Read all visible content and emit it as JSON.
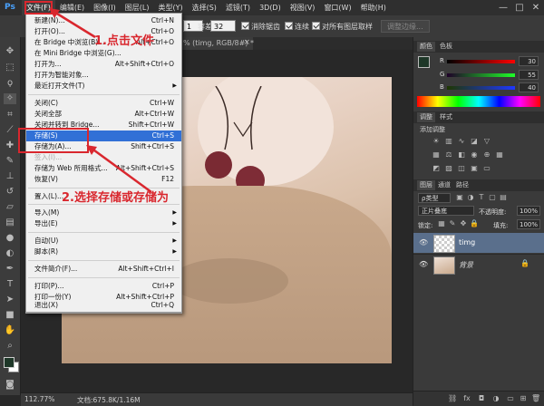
{
  "menubar": {
    "items": [
      "文件(F)",
      "编辑(E)",
      "图像(I)",
      "图层(L)",
      "类型(Y)",
      "选择(S)",
      "滤镜(T)",
      "3D(D)",
      "视图(V)",
      "窗口(W)",
      "帮助(H)"
    ],
    "window_controls": [
      "—",
      "□",
      "✕"
    ]
  },
  "options": {
    "size_value": "1",
    "tolerance_label": "容差:",
    "tolerance_value": "32",
    "antialias_label": "消除锯齿",
    "contiguous_label": "连续",
    "all_layers_label": "对所有图层取样",
    "refine_edge_label": "调整边缘..."
  },
  "document": {
    "tab_title": "% (timg, RGB/8#) *",
    "tab_close": "×",
    "zoom": "112.77%",
    "doc_info": "文档:675.8K/1.16M"
  },
  "file_menu": {
    "items": [
      {
        "label": "新建(N)...",
        "shortcut": "Ctrl+N"
      },
      {
        "label": "打开(O)...",
        "shortcut": "Ctrl+O"
      },
      {
        "label": "在 Bridge 中浏览(B)...",
        "shortcut": "Alt+Ctrl+O"
      },
      {
        "label": "在 Mini Bridge 中浏览(G)...",
        "shortcut": ""
      },
      {
        "label": "打开为...",
        "shortcut": "Alt+Shift+Ctrl+O"
      },
      {
        "label": "打开为智能对象...",
        "shortcut": ""
      },
      {
        "label": "最近打开文件(T)",
        "shortcut": ""
      },
      {
        "label": "关闭(C)",
        "shortcut": "Ctrl+W"
      },
      {
        "label": "关闭全部",
        "shortcut": "Alt+Ctrl+W"
      },
      {
        "label": "关闭并转到 Bridge...",
        "shortcut": "Shift+Ctrl+W"
      },
      {
        "label": "存储(S)",
        "shortcut": "Ctrl+S"
      },
      {
        "label": "存储为(A)...",
        "shortcut": "Shift+Ctrl+S"
      },
      {
        "label": "签入(I)...",
        "shortcut": ""
      },
      {
        "label": "存储为 Web 所用格式...",
        "shortcut": "Alt+Shift+Ctrl+S"
      },
      {
        "label": "恢复(V)",
        "shortcut": "F12"
      },
      {
        "label": "置入(L)...",
        "shortcut": ""
      },
      {
        "label": "导入(M)",
        "shortcut": ""
      },
      {
        "label": "导出(E)",
        "shortcut": ""
      },
      {
        "label": "自动(U)",
        "shortcut": ""
      },
      {
        "label": "脚本(R)",
        "shortcut": ""
      },
      {
        "label": "文件简介(F)...",
        "shortcut": "Alt+Shift+Ctrl+I"
      },
      {
        "label": "打印(P)...",
        "shortcut": "Ctrl+P"
      },
      {
        "label": "打印一份(Y)",
        "shortcut": "Alt+Shift+Ctrl+P"
      },
      {
        "label": "退出(X)",
        "shortcut": "Ctrl+Q"
      }
    ]
  },
  "annotations": {
    "step1": "1.点击文件",
    "step2": "2.选择存储或存储为"
  },
  "color_panel": {
    "tabs": [
      "颜色",
      "色板"
    ],
    "r_label": "R",
    "g_label": "G",
    "b_label": "B",
    "r_value": "30",
    "g_value": "55",
    "b_value": "40"
  },
  "adjust_panel": {
    "tabs": [
      "调整",
      "样式"
    ],
    "title": "添加调整"
  },
  "layers_panel": {
    "tabs": [
      "图层",
      "通道",
      "路径"
    ],
    "kind_label": "ρ类型",
    "blend_mode": "正片叠底",
    "opacity_label": "不透明度:",
    "opacity_value": "100%",
    "lock_label": "锁定:",
    "fill_label": "填充:",
    "fill_value": "100%",
    "layers": [
      {
        "name": "timg"
      },
      {
        "name": "背景"
      }
    ],
    "footer_icons": [
      "link-icon",
      "fx-icon",
      "mask-icon",
      "adjustment-icon",
      "folder-icon",
      "new-layer-icon",
      "trash-icon"
    ]
  },
  "colors": {
    "accent_red": "#d9272e",
    "menu_highlight": "#3170d6",
    "foreground_color": "#1e3728"
  }
}
